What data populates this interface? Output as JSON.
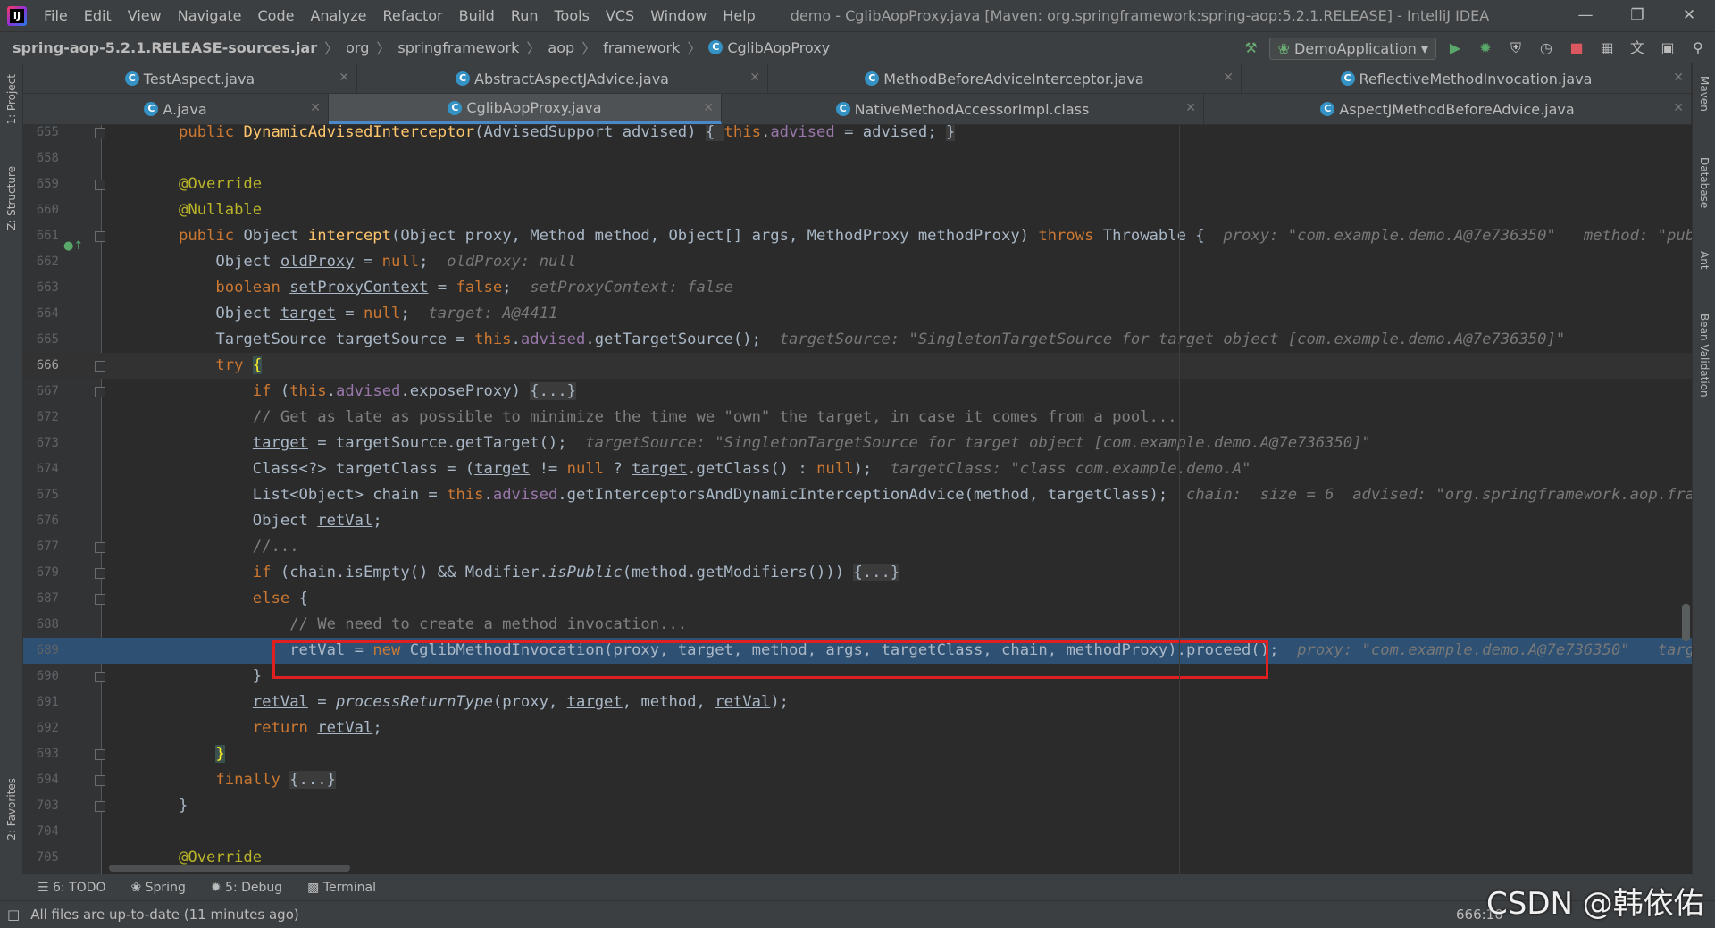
{
  "menu": {
    "items": [
      "File",
      "Edit",
      "View",
      "Navigate",
      "Code",
      "Analyze",
      "Refactor",
      "Build",
      "Run",
      "Tools",
      "VCS",
      "Window",
      "Help"
    ],
    "title": "demo - CglibAopProxy.java [Maven: org.springframework:spring-aop:5.2.1.RELEASE] - IntelliJ IDEA"
  },
  "nav": {
    "crumbs": [
      "spring-aop-5.2.1.RELEASE-sources.jar",
      "org",
      "springframework",
      "aop",
      "framework",
      "CglibAopProxy"
    ],
    "run_config": "DemoApplication"
  },
  "tabs_row1": [
    "TestAspect.java",
    "AbstractAspectJAdvice.java",
    "MethodBeforeAdviceInterceptor.java",
    "ReflectiveMethodInvocation.java"
  ],
  "tabs_row2": [
    "A.java",
    "CglibAopProxy.java",
    "NativeMethodAccessorImpl.class",
    "AspectJMethodBeforeAdvice.java"
  ],
  "left_strip": [
    "1: Project",
    "Z: Structure",
    "2: Favorites"
  ],
  "right_strip": [
    "Maven",
    "Database",
    "Ant",
    "Bean Validation"
  ],
  "lines": [
    {
      "n": "655",
      "html": "<span class='kw'>public </span><span class='fn'>DynamicAdvisedInterceptor</span>(AdvisedSupport advised) <span style='background:#3b3b3b'>{ </span><span class='kw'>this</span>.<span class='fd'>advised</span> = advised; <span style='background:#3b3b3b'>}</span>"
    },
    {
      "n": "658",
      "html": ""
    },
    {
      "n": "659",
      "html": "<span class='an'>@Override</span>"
    },
    {
      "n": "660",
      "html": "<span class='an'>@Nullable</span>"
    },
    {
      "n": "661",
      "html": "<span class='kw'>public </span>Object <span class='fn'>intercept</span>(Object proxy, Method method, Object[] args, MethodProxy methodProxy) <span class='kw'>throws </span>Throwable {  <span class='hint'>proxy: \"com.example.demo.A@7e736350\"   method: \"public vo</span>"
    },
    {
      "n": "662",
      "html": "    Object <span class='ul'>oldProxy</span> = <span class='kw'>null</span>;  <span class='hint'>oldProxy: null</span>"
    },
    {
      "n": "663",
      "html": "    <span class='kw'>boolean </span><span class='ul'>setProxyContext</span> = <span class='kw'>false</span>;  <span class='hint'>setProxyContext: false</span>"
    },
    {
      "n": "664",
      "html": "    Object <span class='ul'>target</span> = <span class='kw'>null</span>;  <span class='hint'>target: A@4411</span>"
    },
    {
      "n": "665",
      "html": "    TargetSource targetSource = <span class='kw'>this</span>.<span class='fd'>advised</span>.getTargetSource();  <span class='hint'>targetSource: \"SingletonTargetSource for target object [com.example.demo.A@7e736350]\"</span>"
    },
    {
      "n": "666",
      "html": "    <span class='kw'>try </span><span style='color:#ffef28;background:#3b514d'>{</span>"
    },
    {
      "n": "667",
      "html": "        <span class='kw'>if </span>(<span class='kw'>this</span>.<span class='fd'>advised</span>.exposeProxy) <span style='background:#3b3b3b'>{...}</span>"
    },
    {
      "n": "672",
      "html": "        <span class='cm'>// Get as late as possible to minimize the time we \"own\" the target, in case it comes from a pool...</span>"
    },
    {
      "n": "673",
      "html": "        <span class='ul'>target</span> = targetSource.getTarget();  <span class='hint'>targetSource: \"SingletonTargetSource for target object [com.example.demo.A@7e736350]\"</span>"
    },
    {
      "n": "674",
      "html": "        Class&lt;?&gt; targetClass = (<span class='ul'>target</span> != <span class='kw'>null </span>? <span class='ul'>target</span>.getClass() : <span class='kw'>null</span>);  <span class='hint'>targetClass: \"class com.example.demo.A\"</span>"
    },
    {
      "n": "675",
      "html": "        List&lt;Object&gt; chain = <span class='kw'>this</span>.<span class='fd'>advised</span>.getInterceptorsAndDynamicInterceptionAdvice(method, targetClass);  <span class='hint'>chain:  size = 6  advised: \"org.springframework.aop.framewor</span>"
    },
    {
      "n": "676",
      "html": "        Object <span class='ul'>retVal</span>;"
    },
    {
      "n": "677",
      "html": "        <span class='cm'>//...</span>"
    },
    {
      "n": "679",
      "html": "        <span class='kw'>if </span>(chain.isEmpty() &amp;&amp; Modifier.<span class='it'>isPublic</span>(method.getModifiers())) <span style='background:#3b3b3b'>{...}</span>"
    },
    {
      "n": "687",
      "html": "        <span class='kw'>else </span>{"
    },
    {
      "n": "688",
      "html": "            <span class='cm'>// We need to create a method invocation...</span>"
    },
    {
      "n": "689",
      "html": "            <span class='ul'>retVal</span> = <span class='kw'>new </span>CglibMethodInvocation(proxy, <span class='ul'>target</span>, method, args, targetClass, chain, methodProxy).proceed();  <span class='hint'>proxy: \"com.example.demo.A@7e736350\"   target: A@</span>"
    },
    {
      "n": "690",
      "html": "        }"
    },
    {
      "n": "691",
      "html": "        <span class='ul'>retVal</span> = <span class='it'>processReturnType</span>(proxy, <span class='ul'>target</span>, method, <span class='ul'>retVal</span>);"
    },
    {
      "n": "692",
      "html": "        <span class='kw'>return </span><span class='ul'>retVal</span>;"
    },
    {
      "n": "693",
      "html": "    <span style='color:#ffef28;background:#3b514d'>}</span>"
    },
    {
      "n": "694",
      "html": "    <span class='kw'>finally </span><span style='background:#3b3b3b'>{...}</span>"
    },
    {
      "n": "703",
      "html": "}"
    },
    {
      "n": "704",
      "html": ""
    },
    {
      "n": "705",
      "html": "<span class='an'>@Override</span>"
    }
  ],
  "bottom_tools": [
    "6: TODO",
    "Spring",
    "5: Debug",
    "Terminal"
  ],
  "status": {
    "message": "All files are up-to-date (11 minutes ago)",
    "position": "666:10"
  },
  "watermark": "CSDN @韩依佑"
}
